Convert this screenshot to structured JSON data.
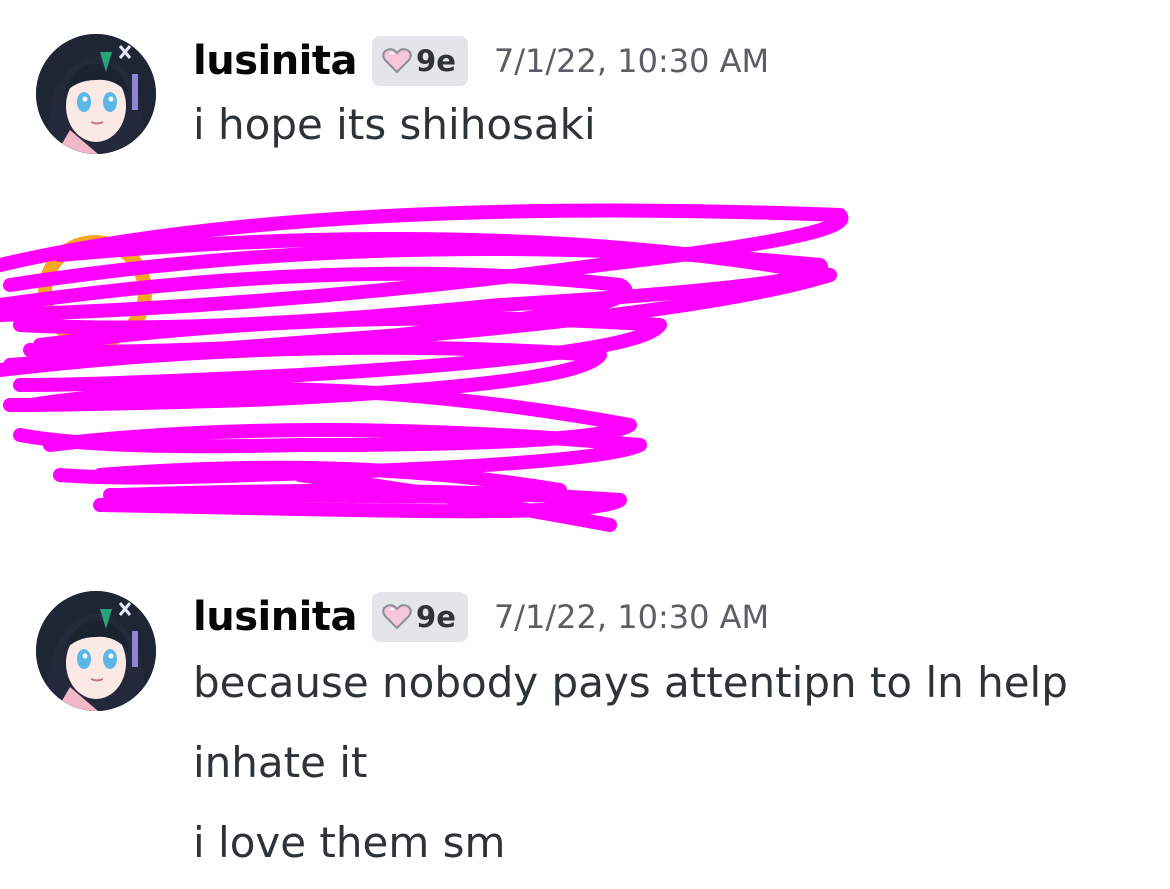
{
  "messages": [
    {
      "author": "lusinita",
      "tag": "9e",
      "tag_icon": "heart-icon",
      "timestamp": "7/1/22, 10:30 AM",
      "lines": [
        "i hope its shihosaki"
      ]
    },
    {
      "author": "lusinita",
      "tag": "9e",
      "tag_icon": "heart-icon",
      "timestamp": "7/1/22, 10:30 AM",
      "lines": [
        "because nobody pays attentipn to ln help",
        "inhate it",
        "i love them sm"
      ]
    }
  ],
  "redaction": {
    "color": "#ff00ff"
  }
}
